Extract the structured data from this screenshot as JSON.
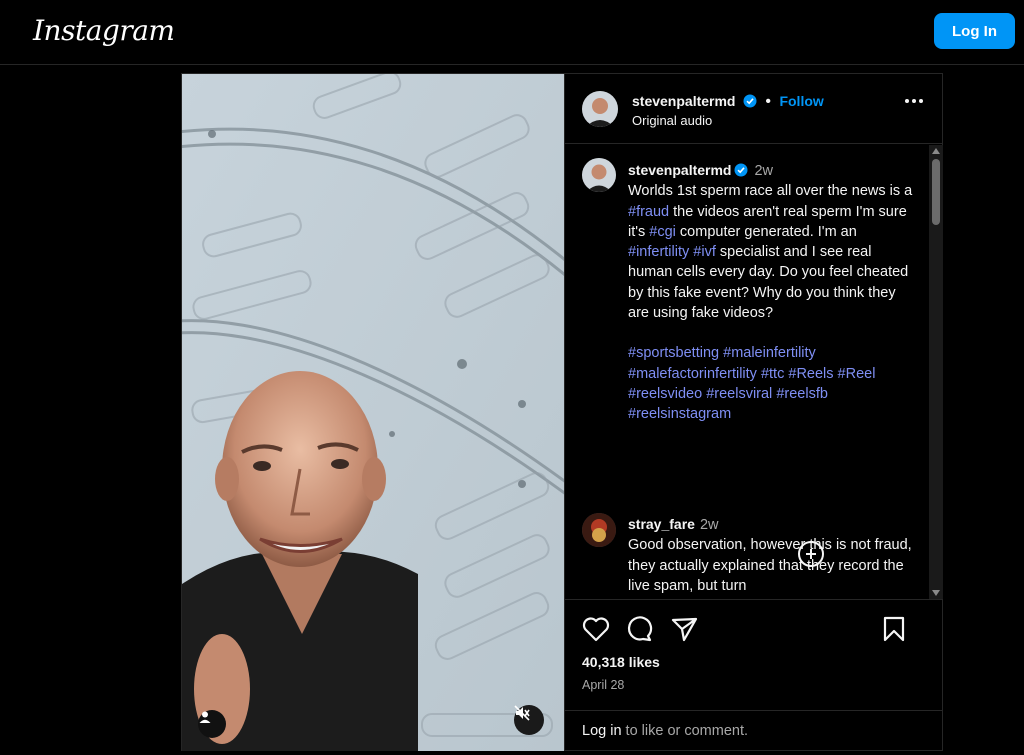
{
  "header": {
    "logo_text": "Instagram",
    "login_label": "Log In"
  },
  "post": {
    "author": "stevenpaltermd",
    "follow_label": "Follow",
    "audio_label": "Original audio",
    "caption": {
      "username": "stevenpaltermd",
      "time": "2w",
      "parts": [
        {
          "t": "Worlds 1st sperm race all over the news is a "
        },
        {
          "t": "#fraud",
          "tag": true
        },
        {
          "t": " the videos aren't real sperm I'm sure it's "
        },
        {
          "t": "#cgi",
          "tag": true
        },
        {
          "t": " computer generated. I'm an "
        },
        {
          "t": "#infertility",
          "tag": true
        },
        {
          "t": " "
        },
        {
          "t": "#ivf",
          "tag": true
        },
        {
          "t": " specialist and I see real human cells every day. Do you feel cheated by this fake event? Why do you think they are using fake videos?"
        }
      ],
      "hashtags": [
        "#sportsbetting",
        "#maleinfertility",
        "#malefactorinfertility",
        "#ttc",
        "#Reels",
        "#Reel",
        "#reelsvideo",
        "#reelsviral",
        "#reelsfb",
        "#reelsinstagram"
      ]
    },
    "comment": {
      "username": "stray_fare",
      "time": "2w",
      "text": "Good observation, however this is not fraud, they actually explained that they record the live spam, but turn"
    },
    "likes": "40,318 likes",
    "date": "April 28",
    "login_prompt": {
      "link": "Log in",
      "rest": " to like or comment."
    }
  },
  "icons": [
    "like-icon",
    "comment-icon",
    "share-icon",
    "save-icon",
    "more-options-icon",
    "verified-badge-icon",
    "add-comment-icon",
    "user-tag-icon",
    "muted-icon"
  ],
  "colors": {
    "accent": "#0095f6",
    "hashtag": "#7f8ff4",
    "background": "#000000",
    "secondary_text": "#a8a8a8"
  }
}
